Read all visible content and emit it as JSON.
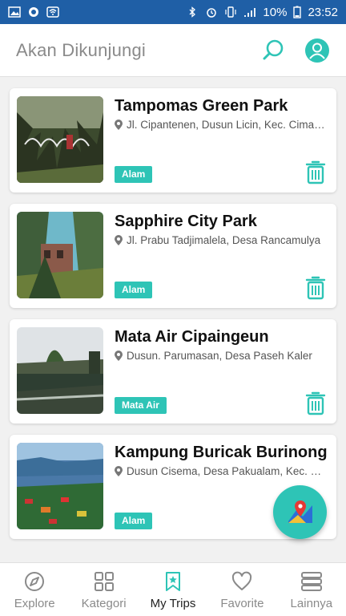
{
  "status_bar": {
    "battery": "10%",
    "time": "23:52"
  },
  "app_bar": {
    "title": "Akan Dikunjungi"
  },
  "places": [
    {
      "name": "Tampomas Green Park",
      "address": "Jl. Cipantenen, Dusun Licin, Kec. Cimalaka",
      "category": "Alam"
    },
    {
      "name": "Sapphire City Park",
      "address": "Jl. Prabu Tadjimalela, Desa Rancamulya",
      "category": "Alam"
    },
    {
      "name": "Mata Air Cipaingeun",
      "address": "Dusun. Parumasan, Desa Paseh Kaler",
      "category": "Mata Air"
    },
    {
      "name": "Kampung Buricak Burinong",
      "address": "Dusun Cisema, Desa Pakualam, Kec. Darmaraja",
      "category": "Alam"
    }
  ],
  "bottom_nav": [
    {
      "label": "Explore",
      "icon": "compass-icon"
    },
    {
      "label": "Kategori",
      "icon": "grid-icon"
    },
    {
      "label": "My Trips",
      "icon": "bookmark-icon",
      "active": true
    },
    {
      "label": "Favorite",
      "icon": "heart-icon"
    },
    {
      "label": "Lainnya",
      "icon": "menu-stack-icon"
    }
  ],
  "colors": {
    "accent": "#2ec4b6",
    "status_bar": "#1f5fa6"
  }
}
